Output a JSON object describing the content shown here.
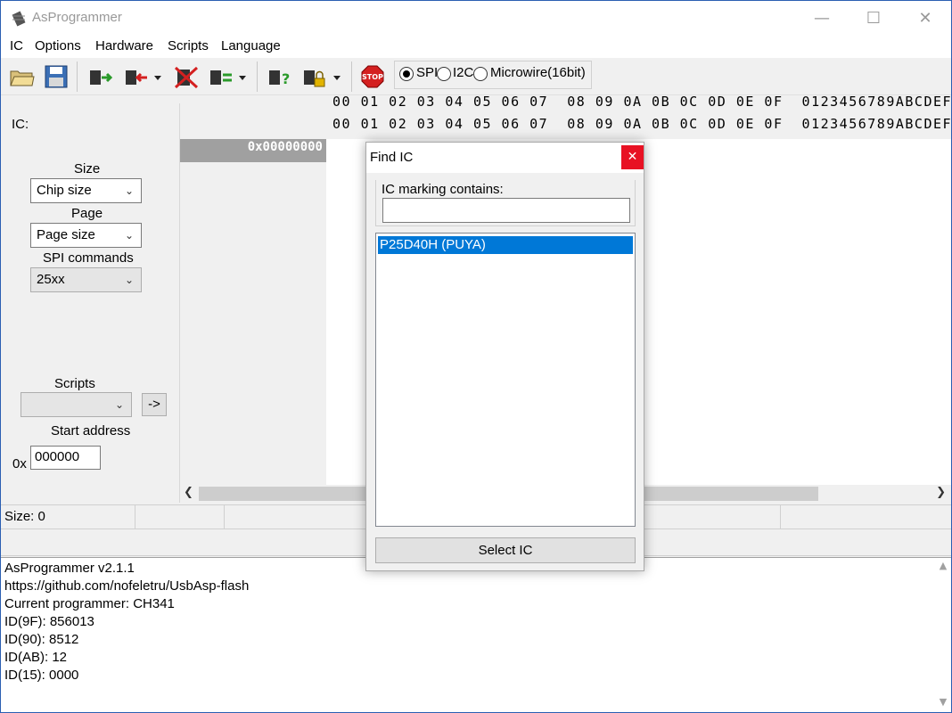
{
  "window": {
    "title": "AsProgrammer",
    "minimize_glyph": "—",
    "maximize_glyph": "☐",
    "close_glyph": "✕"
  },
  "menu": [
    "IC",
    "Options",
    "Hardware",
    "Scripts",
    "Language"
  ],
  "toolbar": {
    "icons": [
      "open-file-icon",
      "save-icon",
      "read-chip-icon",
      "write-chip-icon",
      "erase-chip-icon",
      "verify-icon",
      "read-id-icon",
      "lock-bits-icon",
      "stop-icon"
    ],
    "stop_label": "STOP",
    "protocol": {
      "options": [
        "SPI",
        "I2C",
        "Microwire(16bit)"
      ],
      "selected": "SPI"
    }
  },
  "left_panel": {
    "ic_label": "IC:",
    "size_label": "Size",
    "size_value": "Chip size",
    "page_label": "Page",
    "page_value": "Page size",
    "spi_commands_label": "SPI commands",
    "spi_commands_value": "25xx",
    "scripts_label": "Scripts",
    "scripts_value": "",
    "run_script_label": "->",
    "start_address_label": "Start address",
    "start_address_prefix": "0x",
    "start_address_value": "000000"
  },
  "hex": {
    "header_row1": "00 01 02 03 04 05 06 07  08 09 0A 0B 0C 0D 0E 0F  0123456789ABCDEF",
    "header_row2": "00 01 02 03 04 05 06 07  08 09 0A 0B 0C 0D 0E 0F  0123456789ABCDEF",
    "first_address": "0x00000000"
  },
  "status": {
    "size_text": "Size: 0"
  },
  "log": [
    "AsProgrammer v2.1.1",
    "https://github.com/nofeletru/UsbAsp-flash",
    "Current programmer: CH341",
    "ID(9F): 856013",
    "ID(90): 8512",
    "ID(AB): 12",
    "ID(15): 0000"
  ],
  "find_ic_dialog": {
    "title": "Find IC",
    "close_glyph": "✕",
    "search_label": "IC marking contains:",
    "search_value": "",
    "results": [
      "P25D40H (PUYA)"
    ],
    "select_button": "Select IC"
  },
  "colors": {
    "selection": "#0078d7",
    "close_red": "#e81123"
  }
}
